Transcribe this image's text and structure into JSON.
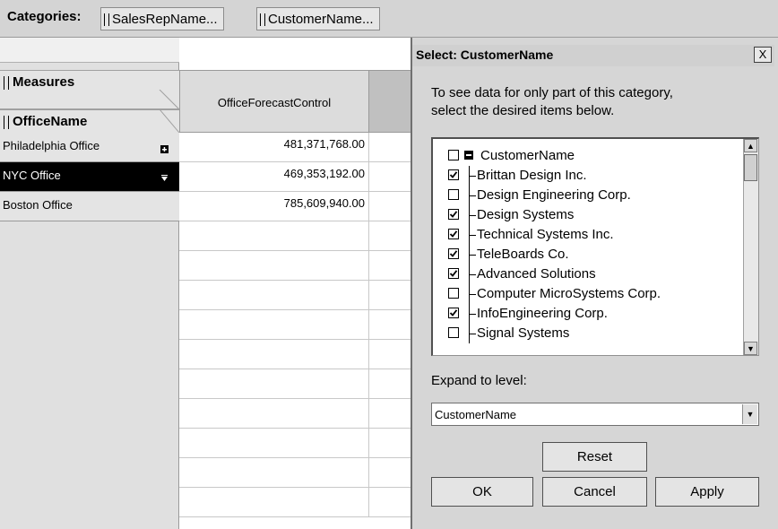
{
  "categories_bar": {
    "label": "Categories:",
    "chips": [
      "SalesRepName...",
      "CustomerName..."
    ]
  },
  "tabs": {
    "measures": "Measures",
    "office_name": "OfficeName"
  },
  "grid": {
    "column_header": "OfficeForecastControl",
    "rows": [
      {
        "label": "Philadelphia Office",
        "value": "481,371,768.00",
        "icon": "expand-icon"
      },
      {
        "label": "NYC Office",
        "value": "469,353,192.00",
        "icon": "collapse-icon"
      },
      {
        "label": "Boston Office",
        "value": "785,609,940.00",
        "icon": ""
      }
    ]
  },
  "dialog": {
    "title": "Select: CustomerName",
    "close": "X",
    "instruction_line1": "To see data for only part of this category,",
    "instruction_line2": "select the desired items below.",
    "root_label": "CustomerName",
    "items": [
      {
        "label": "Brittan Design Inc.",
        "checked": true
      },
      {
        "label": "Design Engineering Corp.",
        "checked": false
      },
      {
        "label": "Design Systems",
        "checked": true
      },
      {
        "label": "Technical Systems Inc.",
        "checked": true
      },
      {
        "label": "TeleBoards Co.",
        "checked": true
      },
      {
        "label": "Advanced Solutions",
        "checked": true
      },
      {
        "label": "Computer MicroSystems Corp.",
        "checked": false
      },
      {
        "label": "InfoEngineering Corp.",
        "checked": true
      },
      {
        "label": "Signal Systems",
        "checked": false
      }
    ],
    "expand_label": "Expand to level:",
    "expand_value": "CustomerName",
    "buttons": {
      "reset": "Reset",
      "ok": "OK",
      "cancel": "Cancel",
      "apply": "Apply"
    }
  }
}
